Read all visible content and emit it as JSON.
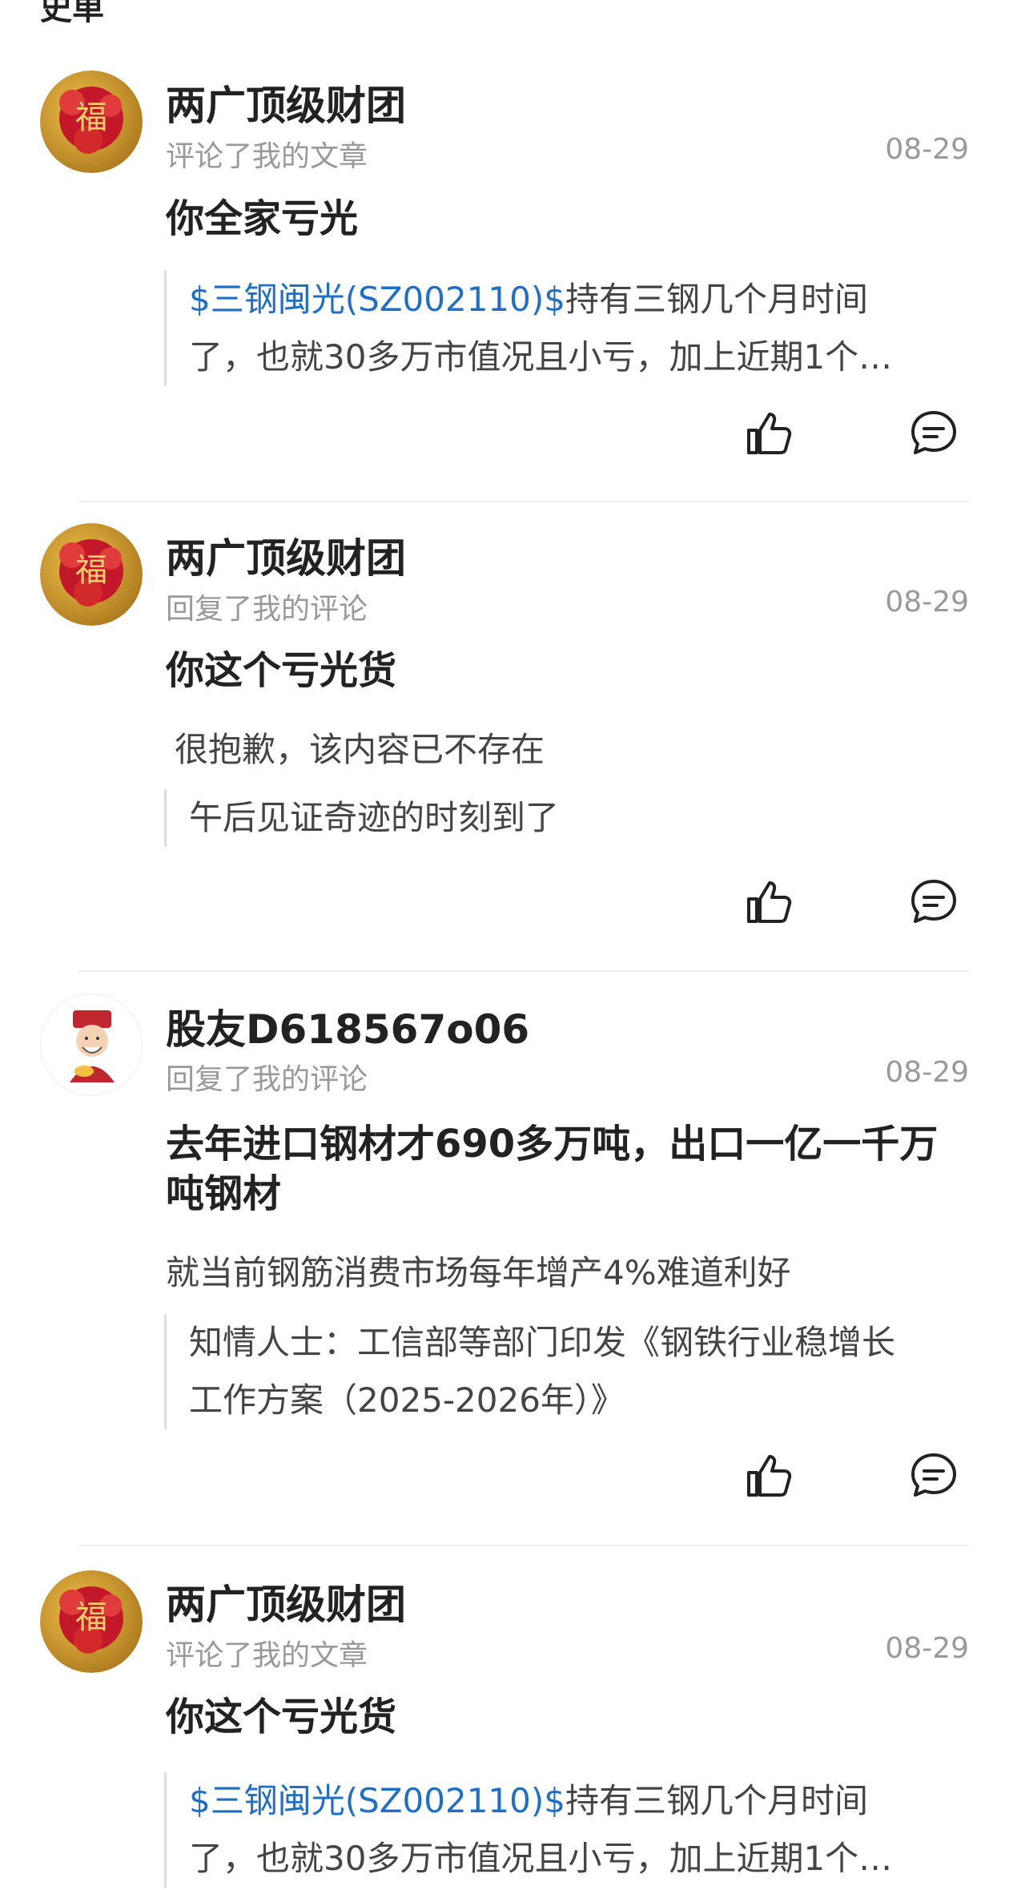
{
  "header": {
    "fragment": "史单"
  },
  "notifications": [
    {
      "username": "两广顶级财团",
      "action": "评论了我的文章",
      "date": "08-29",
      "content": "你全家亏光",
      "plain": "",
      "quote_link": "$三钢闽光(SZ002110)$",
      "quote_line1": "持有三钢几个月时间",
      "quote_line2": "了，也就30多万市值况且小亏，加上近期1个…",
      "avatar": "red-gold-lucky-icon"
    },
    {
      "username": "两广顶级财团",
      "action": "回复了我的评论",
      "date": "08-29",
      "content": "你这个亏光货",
      "plain": "很抱歉，该内容已不存在",
      "quote_link": "",
      "quote_line1": "午后见证奇迹的时刻到了",
      "quote_line2": "",
      "avatar": "red-gold-lucky-icon"
    },
    {
      "username": "股友D618567o06",
      "action": "回复了我的评论",
      "date": "08-29",
      "content": "去年进口钢材才690多万吨，出口一亿一千万吨钢材",
      "plain": "就当前钢筋消费市场每年增产4%难道利好",
      "quote_link": "",
      "quote_line1": "知情人士：工信部等部门印发《钢铁行业稳增长",
      "quote_line2": "工作方案（2025-2026年）》",
      "avatar": "god-of-wealth-icon"
    },
    {
      "username": "两广顶级财团",
      "action": "评论了我的文章",
      "date": "08-29",
      "content": "你这个亏光货",
      "plain": "",
      "quote_link": "$三钢闽光(SZ002110)$",
      "quote_line1": "持有三钢几个月时间",
      "quote_line2": "了，也就30多万市值况且小亏，加上近期1个…",
      "avatar": "red-gold-lucky-icon"
    }
  ],
  "icons": {
    "like": "thumbs-up-icon",
    "comment": "comment-bubble-icon"
  },
  "colors": {
    "link": "#1f6fc6",
    "meta": "#999999",
    "divider": "#eeeeee"
  }
}
